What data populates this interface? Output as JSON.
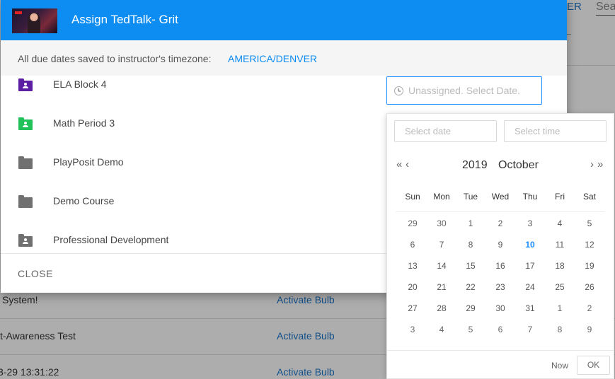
{
  "background": {
    "tab_fragment": "ER",
    "search_fragment": "Sea",
    "rows": [
      {
        "title": "System!",
        "link": "Activate Bulb"
      },
      {
        "title": "t-Awareness Test",
        "link": "Activate Bulb"
      },
      {
        "title": "3-29 13:31:22",
        "link": "Activate Bulb"
      }
    ]
  },
  "dialog": {
    "title": "Assign TedTalk- Grit",
    "timezone_label": "All due dates saved to instructor's timezone:",
    "timezone_value": "AMERICA/DENVER",
    "courses": [
      {
        "name": "ELA Block 4",
        "icon": "shared-folder-icon",
        "color": "#5c1ea3"
      },
      {
        "name": "Math Period 3",
        "icon": "shared-folder-icon",
        "color": "#22c25a"
      },
      {
        "name": "PlayPosit Demo",
        "icon": "folder-icon",
        "color": "#707070"
      },
      {
        "name": "Demo Course",
        "icon": "folder-icon",
        "color": "#707070"
      },
      {
        "name": "Professional Development",
        "icon": "shared-folder-icon",
        "color": "#707070"
      }
    ],
    "date_input_placeholder": "Unassigned. Select Date.",
    "close_label": "CLOSE"
  },
  "datepicker": {
    "date_placeholder": "Select date",
    "time_placeholder": "Select time",
    "prev_year": "«",
    "prev_month": "‹",
    "next_month": "›",
    "next_year": "»",
    "year": "2019",
    "month": "October",
    "weekdays": [
      "Sun",
      "Mon",
      "Tue",
      "Wed",
      "Thu",
      "Fri",
      "Sat"
    ],
    "weeks": [
      [
        "29",
        "30",
        "1",
        "2",
        "3",
        "4",
        "5"
      ],
      [
        "6",
        "7",
        "8",
        "9",
        "10",
        "11",
        "12"
      ],
      [
        "13",
        "14",
        "15",
        "16",
        "17",
        "18",
        "19"
      ],
      [
        "20",
        "21",
        "22",
        "23",
        "24",
        "25",
        "26"
      ],
      [
        "27",
        "28",
        "29",
        "30",
        "31",
        "1",
        "2"
      ],
      [
        "3",
        "4",
        "5",
        "6",
        "7",
        "8",
        "9"
      ]
    ],
    "today": "10",
    "now_label": "Now",
    "ok_label": "OK"
  },
  "colors": {
    "header_blue": "#0d8df2",
    "link_blue": "#1a73c8",
    "today_blue": "#1a8cff"
  }
}
